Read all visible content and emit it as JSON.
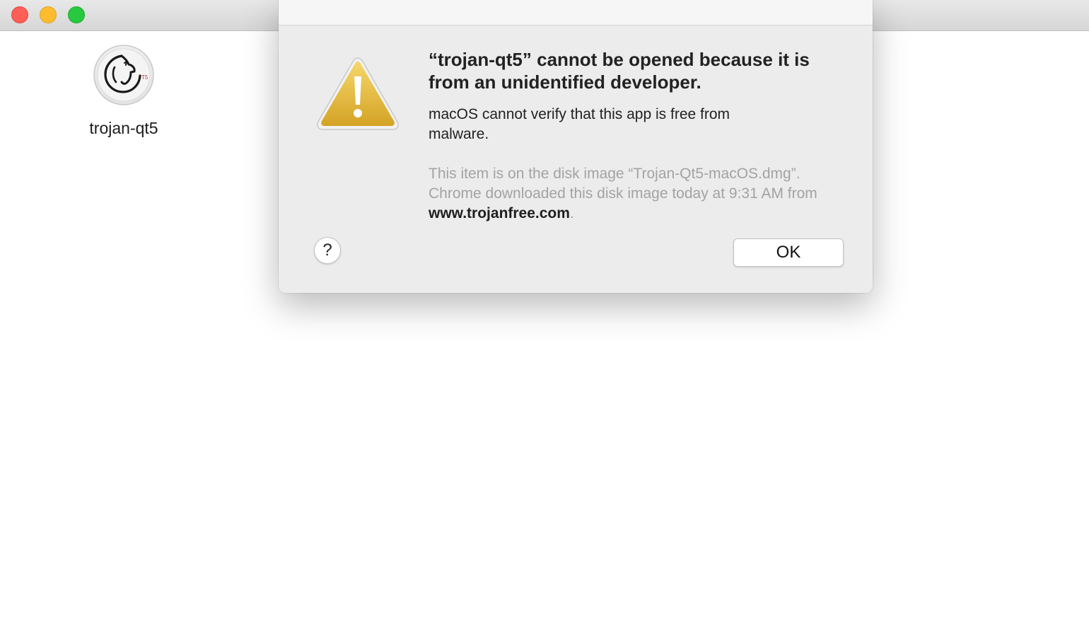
{
  "window": {
    "controls": [
      "close",
      "minimize",
      "zoom"
    ],
    "colors": {
      "close": "#fe5f57",
      "minimize": "#febc2e",
      "zoom": "#28c840"
    }
  },
  "desktop": {
    "app": {
      "name": "trojan-qt5",
      "icon": "trojan-knight-icon",
      "icon_badge": "T5"
    }
  },
  "dialog": {
    "icon": "warning-triangle-icon",
    "title": "“trojan-qt5” cannot be opened because it is from an unidentified developer.",
    "message": "macOS cannot verify that this app is free from malware.",
    "info_prefix": "This item is on the disk image “Trojan-Qt5-macOS.dmg”. Chrome downloaded this disk image today at 9:31 AM from ",
    "info_link": "www.trojanfree.com",
    "info_suffix": ".",
    "help_label": "?",
    "ok_label": "OK"
  }
}
